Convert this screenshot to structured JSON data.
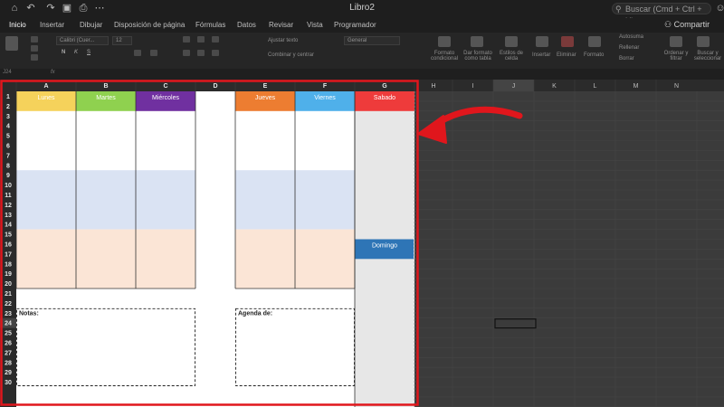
{
  "window": {
    "title": "Libro2"
  },
  "search": {
    "placeholder": "Buscar (Cmd + Ctrl + U)"
  },
  "tabs": [
    "Inicio",
    "Insertar",
    "Dibujar",
    "Disposición de página",
    "Fórmulas",
    "Datos",
    "Revisar",
    "Vista",
    "Programador"
  ],
  "share_label": "Compartir",
  "ribbon": {
    "font_name": "Calibri (Cuer...",
    "font_size": "12",
    "wrap_text": "Ajustar texto",
    "merge_center": "Combinar y centrar",
    "number_format": "General",
    "conditional_format": "Formato condicional",
    "format_as_table": "Dar formato como tabla",
    "cell_styles": "Estilos de celda",
    "insert": "Insertar",
    "delete": "Eliminar",
    "format": "Formato",
    "autosum": "Autosuma",
    "fill": "Rellenar",
    "clear": "Borrar",
    "sort_filter": "Ordenar y filtrar",
    "find_select": "Buscar y seleccionar"
  },
  "formula_bar": {
    "name_box": "J24",
    "fx": "fx"
  },
  "grid": {
    "column_headers": [
      "A",
      "B",
      "C",
      "D",
      "E",
      "F",
      "G",
      "H",
      "I",
      "J",
      "K",
      "L",
      "M",
      "N"
    ],
    "row_headers": [
      "1",
      "2",
      "3",
      "4",
      "5",
      "6",
      "7",
      "8",
      "9",
      "10",
      "11",
      "12",
      "13",
      "14",
      "15",
      "16",
      "17",
      "18",
      "19",
      "20",
      "21",
      "22",
      "23",
      "24",
      "25",
      "26",
      "27",
      "28",
      "29",
      "30"
    ],
    "selected_cell": "J24"
  },
  "planner": {
    "days": [
      {
        "label": "Lunes",
        "color": "#f5d25b"
      },
      {
        "label": "Martes",
        "color": "#8fd14f"
      },
      {
        "label": "Miércoles",
        "color": "#7030a0"
      },
      {
        "label": "Jueves",
        "color": "#ed7d31"
      },
      {
        "label": "Viernes",
        "color": "#4fb0ea"
      },
      {
        "label": "Sabado",
        "color": "#ee3b3b"
      }
    ],
    "sunday": {
      "label": "Domingo",
      "color": "#2e75b6"
    },
    "notes_label": "Notas:",
    "agenda_label": "Agenda de:",
    "band_colors": {
      "white": "#ffffff",
      "blue": "#dae3f3",
      "peach": "#fbe5d6",
      "gray": "#e7e7e7"
    }
  },
  "annotation": {
    "highlight_color": "#e0161c"
  }
}
